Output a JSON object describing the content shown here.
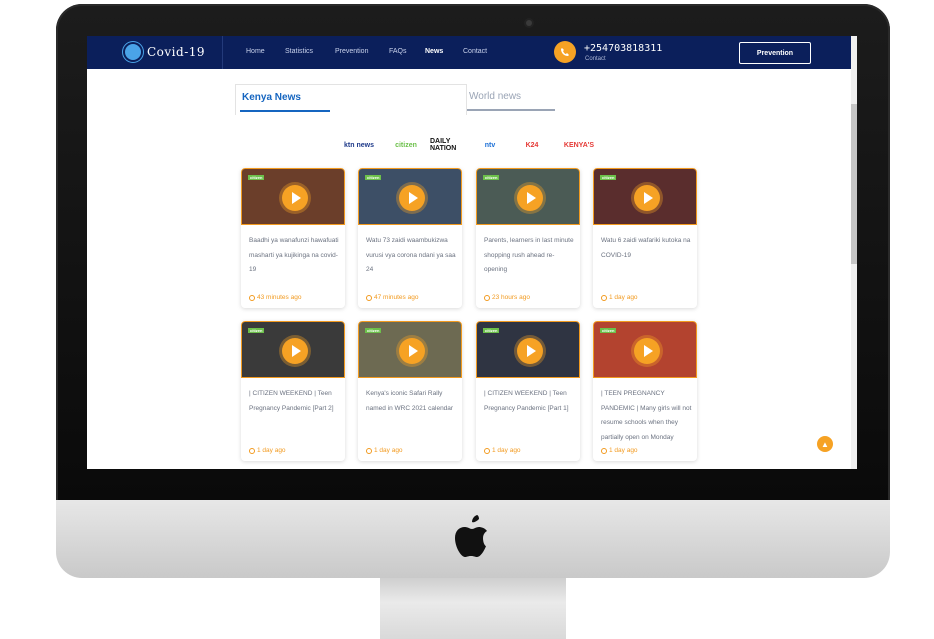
{
  "brand": {
    "name": "Covid-19"
  },
  "nav": {
    "links": [
      "Home",
      "Statistics",
      "Prevention",
      "FAQs",
      "News",
      "Contact"
    ],
    "active": "News",
    "phone": "+254703818311",
    "phone_sub": "Contact",
    "button": "Prevention"
  },
  "tabs": {
    "kenya": "Kenya News",
    "world": "World news"
  },
  "media_logos": [
    {
      "name": "ktn news",
      "color": "#1e3a8a"
    },
    {
      "name": "citizen",
      "color": "#6cc04a"
    },
    {
      "name": "DAILY NATION",
      "color": "#111111"
    },
    {
      "name": "ntv",
      "color": "#1b6fd6"
    },
    {
      "name": "K24",
      "color": "#e53935"
    },
    {
      "name": "KENYA'S",
      "color": "#e53935"
    }
  ],
  "cards": [
    {
      "title": "Baadhi ya wanafunzi hawafuati masharti ya kujikinga na covid-19",
      "time": "43 minutes ago",
      "thumb": "#6b3e2a"
    },
    {
      "title": "Watu 73 zaidi waambukizwa vurusi vya corona ndani ya saa 24",
      "time": "47 minutes ago",
      "thumb": "#3d4f66"
    },
    {
      "title": "Parents, learners in last minute shopping rush ahead re-opening",
      "time": "23 hours ago",
      "thumb": "#4b5b55"
    },
    {
      "title": "Watu 6 zaidi wafariki kutoka na COVID-19",
      "time": "1 day ago",
      "thumb": "#5a2d2d"
    },
    {
      "title": "| CITIZEN WEEKEND | Teen Pregnancy Pandemic [Part 2]",
      "time": "1 day ago",
      "thumb": "#3a3a3a"
    },
    {
      "title": "Kenya's iconic Safari Rally named in WRC 2021 calendar",
      "time": "1 day ago",
      "thumb": "#6d6a52"
    },
    {
      "title": "| CITIZEN WEEKEND | Teen Pregnancy Pandemic [Part 1]",
      "time": "1 day ago",
      "thumb": "#2f3442"
    },
    {
      "title": "| TEEN PREGNANCY PANDEMIC | Many girls will not resume schools when they partially open on Monday",
      "time": "1 day ago",
      "thumb": "#b3432f"
    }
  ],
  "badge_text": "citizen"
}
